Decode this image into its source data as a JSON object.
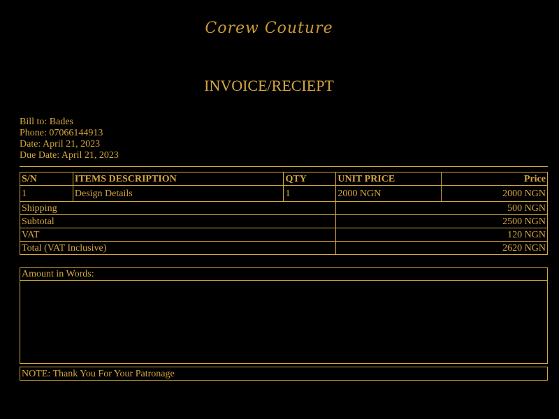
{
  "brand": {
    "logo_text": "Corew Couture",
    "accent_color": "#d4a640",
    "background_color": "#000000"
  },
  "document": {
    "title": "INVOICE/RECIEPT"
  },
  "bill_to": {
    "bill": "Bill to: Bades",
    "phone": "Phone: 07066144913",
    "date": "Date: April 21, 2023",
    "due_date": "Due Date: April 21, 2023"
  },
  "items_table": {
    "headers": {
      "sn": "S/N",
      "description": "ITEMS DESCRIPTION",
      "qty": "QTY",
      "unit_price": "UNIT PRICE",
      "price": "Price"
    },
    "rows": [
      {
        "sn": "1",
        "description": "Design Details",
        "qty": "1",
        "unit_price": "2000 NGN",
        "price": "2000 NGN"
      }
    ]
  },
  "summary": {
    "shipping_label": "Shipping",
    "shipping_value": "500 NGN",
    "subtotal_label": "Subtotal",
    "subtotal_value": "2500 NGN",
    "vat_label": "VAT",
    "vat_value": "120 NGN",
    "total_label": "Total (VAT Inclusive)",
    "total_value": "2620 NGN"
  },
  "amount_in_words": {
    "label": "Amount in Words:",
    "value": ""
  },
  "note": {
    "text": "NOTE: Thank You For Your Patronage"
  }
}
